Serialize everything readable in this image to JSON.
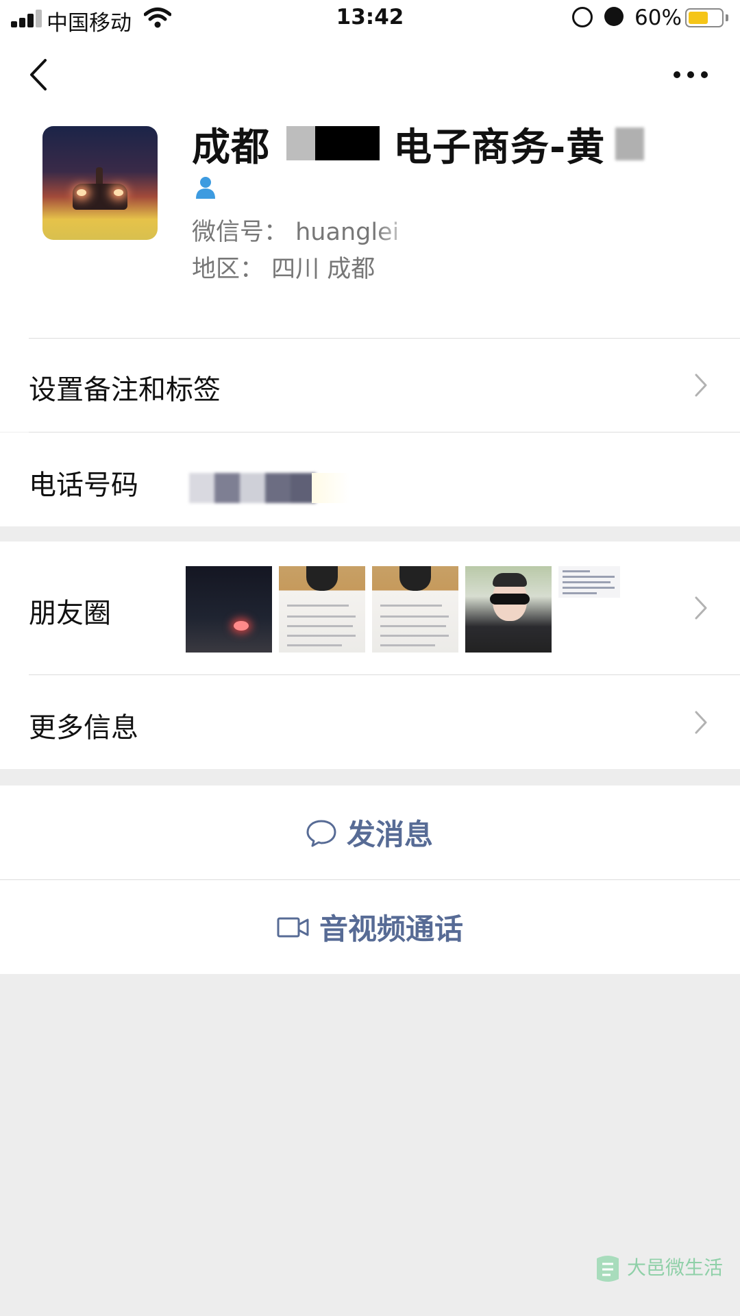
{
  "status_bar": {
    "carrier": "中国移动",
    "time": "13:42",
    "battery": "60%",
    "battery_level": 0.6,
    "icons": [
      "signal-icon",
      "wifi-icon",
      "rotation-lock-icon",
      "alarm-icon",
      "battery-icon"
    ]
  },
  "nav": {
    "back_icon": "chevron-left-icon",
    "more_icon": "more-dots-icon"
  },
  "profile": {
    "name_prefix": "成都",
    "name_suffix": "电子商务-黄",
    "wechat_id": "微信号：  huanglei",
    "region": "地区：  四川 成都",
    "contact_icon": "person-icon"
  },
  "rows": {
    "remark": "设置备注和标签",
    "phone": "电话号码",
    "moments": "朋友圈",
    "more_info": "更多信息"
  },
  "actions": {
    "message": "发消息",
    "call": "音视频通话"
  },
  "watermark": {
    "text": "大邑微生活"
  },
  "colors": {
    "link_blue": "#576b95",
    "background": "#ededed",
    "battery_yellow": "#f5c518"
  }
}
